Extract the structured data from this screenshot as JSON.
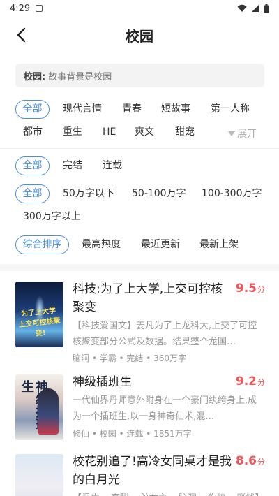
{
  "status_bar": {
    "time": "4:29"
  },
  "nav": {
    "title": "校园"
  },
  "description": {
    "label": "校园:",
    "text": "故事背景是校园"
  },
  "filters": {
    "category": {
      "active": "全部",
      "row1": [
        "现代言情",
        "青春",
        "短故事",
        "第一人称"
      ],
      "row2": [
        "都市",
        "重生",
        "HE",
        "爽文",
        "甜宠"
      ],
      "expand_label": "展开"
    },
    "status": {
      "active": "全部",
      "options": [
        "完结",
        "连载"
      ]
    },
    "word_count": {
      "active": "全部",
      "options": [
        "50万字以下",
        "50-100万字",
        "100-300万字",
        "300万字以上"
      ]
    },
    "sort": {
      "active": "综合排序",
      "options": [
        "最高热度",
        "最近更新",
        "最新上架"
      ]
    }
  },
  "books": [
    {
      "title": "科技:为了上大学,上交可控核聚变",
      "score": "9.5",
      "score_unit": "分",
      "desc": "【科技爱国文】姜凡为了上龙科大,上交了可控核聚变部分公式及数据。结果整个龙国…",
      "meta": "脑洞 • 学霸 • 完结 • 360万字",
      "cover_text": "为了上大学 上交可控核聚变!"
    },
    {
      "title": "神级插班生",
      "score": "9.2",
      "score_unit": "分",
      "desc": "一代仙界丹师意外附身在一个豪门纨绔身上,成为一个插班生,以一身神奇仙术,混…",
      "meta": "修仙 • 校园 • 连载 • 1851万字",
      "cover_text": "神级插班生"
    },
    {
      "title": "校花别追了!高冷女同桌才是我的白月光",
      "score": "8.6",
      "score_unit": "分",
      "desc": "【重生 • 高甜 • 单女主 • 脑洞 • 狗粮 • 赚钱】林夕…",
      "meta": "",
      "cover_text": ""
    }
  ]
}
